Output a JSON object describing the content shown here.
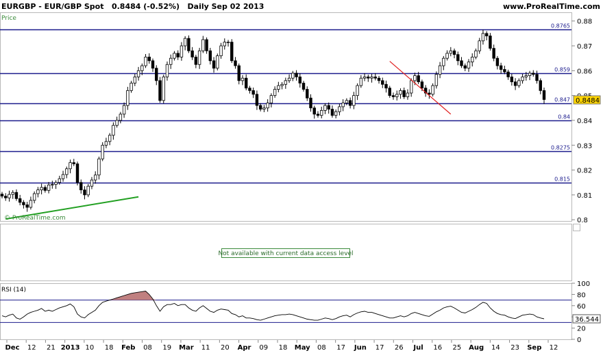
{
  "header": {
    "symbol": "EURGBP - EUR/GBP Spot",
    "price_change": "0.8484 (-0.52%)",
    "period_date": "Daily  Sep 02 2013",
    "site": "www.ProRealTime.com"
  },
  "price_panel": {
    "label": "Price",
    "watermark": "© ProRealTime.com",
    "current_price_label": "0.8484",
    "y_axis_ticks": [
      "0.88",
      "0.87",
      "0.86",
      "0.85",
      "0.84",
      "0.83",
      "0.82",
      "0.81",
      "0.8"
    ],
    "levels": [
      {
        "value": 0.8765,
        "label": "0.8765"
      },
      {
        "value": 0.859,
        "label": "0.859"
      },
      {
        "value": 0.847,
        "label": "0.847"
      },
      {
        "value": 0.84,
        "label": "0.84"
      },
      {
        "value": 0.8275,
        "label": "0.8275"
      },
      {
        "value": 0.815,
        "label": "0.815"
      }
    ]
  },
  "middle_panel": {
    "message": "Not available with current data access level"
  },
  "rsi_panel": {
    "label": "RSI (14)",
    "current_value_label": "36.544",
    "y_axis_ticks": [
      "100",
      "80",
      "60",
      "40",
      "20",
      "0"
    ],
    "upper_band": 70,
    "lower_band": 30
  },
  "x_axis_labels": [
    {
      "text": "Dec",
      "bold": true
    },
    {
      "text": "12",
      "bold": false
    },
    {
      "text": "21",
      "bold": false
    },
    {
      "text": "2013",
      "bold": true
    },
    {
      "text": "10",
      "bold": false
    },
    {
      "text": "18",
      "bold": false
    },
    {
      "text": "Feb",
      "bold": true
    },
    {
      "text": "08",
      "bold": false
    },
    {
      "text": "19",
      "bold": false
    },
    {
      "text": "Mar",
      "bold": true
    },
    {
      "text": "11",
      "bold": false
    },
    {
      "text": "20",
      "bold": false
    },
    {
      "text": "Apr",
      "bold": true
    },
    {
      "text": "09",
      "bold": false
    },
    {
      "text": "18",
      "bold": false
    },
    {
      "text": "May",
      "bold": true
    },
    {
      "text": "08",
      "bold": false
    },
    {
      "text": "17",
      "bold": false
    },
    {
      "text": "Jun",
      "bold": true
    },
    {
      "text": "17",
      "bold": false
    },
    {
      "text": "26",
      "bold": false
    },
    {
      "text": "Jul",
      "bold": true
    },
    {
      "text": "16",
      "bold": false
    },
    {
      "text": "25",
      "bold": false
    },
    {
      "text": "Aug",
      "bold": true
    },
    {
      "text": "14",
      "bold": false
    },
    {
      "text": "23",
      "bold": false
    },
    {
      "text": "Sep",
      "bold": true
    },
    {
      "text": "12",
      "bold": false
    }
  ],
  "chart_data": {
    "type": "candlestick",
    "ylim": [
      0.7995,
      0.8835
    ],
    "price_close": [
      0.8095,
      0.8088,
      0.8102,
      0.811,
      0.8085,
      0.807,
      0.806,
      0.805,
      0.8078,
      0.8105,
      0.812,
      0.813,
      0.8118,
      0.814,
      0.8142,
      0.815,
      0.8165,
      0.8182,
      0.8205,
      0.823,
      0.8225,
      0.815,
      0.812,
      0.81,
      0.8135,
      0.816,
      0.818,
      0.8245,
      0.83,
      0.8315,
      0.834,
      0.838,
      0.84,
      0.8425,
      0.846,
      0.852,
      0.855,
      0.8575,
      0.86,
      0.862,
      0.8655,
      0.864,
      0.861,
      0.856,
      0.848,
      0.8575,
      0.8625,
      0.865,
      0.867,
      0.8655,
      0.87,
      0.873,
      0.868,
      0.8655,
      0.8625,
      0.868,
      0.8725,
      0.868,
      0.864,
      0.861,
      0.866,
      0.87,
      0.8715,
      0.8715,
      0.864,
      0.862,
      0.856,
      0.857,
      0.853,
      0.852,
      0.8505,
      0.846,
      0.8445,
      0.845,
      0.847,
      0.85,
      0.8525,
      0.854,
      0.8545,
      0.856,
      0.857,
      0.859,
      0.8575,
      0.855,
      0.8525,
      0.849,
      0.845,
      0.8425,
      0.842,
      0.844,
      0.846,
      0.8445,
      0.842,
      0.8435,
      0.8455,
      0.847,
      0.848,
      0.846,
      0.85,
      0.854,
      0.857,
      0.8575,
      0.857,
      0.8575,
      0.857,
      0.856,
      0.8545,
      0.853,
      0.85,
      0.8495,
      0.8505,
      0.852,
      0.8495,
      0.851,
      0.856,
      0.858,
      0.8555,
      0.853,
      0.851,
      0.8505,
      0.854,
      0.8585,
      0.862,
      0.865,
      0.867,
      0.868,
      0.8665,
      0.864,
      0.862,
      0.861,
      0.8635,
      0.8655,
      0.868,
      0.872,
      0.875,
      0.874,
      0.869,
      0.865,
      0.862,
      0.8605,
      0.8595,
      0.8575,
      0.8555,
      0.854,
      0.856,
      0.8575,
      0.858,
      0.859,
      0.8585,
      0.856,
      0.852,
      0.8484
    ],
    "rsi": [
      42,
      40,
      43,
      45,
      38,
      36,
      40,
      45,
      48,
      50,
      52,
      55,
      50,
      52,
      50,
      53,
      56,
      58,
      60,
      63,
      58,
      45,
      40,
      38,
      44,
      48,
      52,
      60,
      66,
      68,
      70,
      72,
      74,
      76,
      78,
      80,
      82,
      83,
      84,
      85,
      86,
      80,
      72,
      60,
      50,
      58,
      62,
      62,
      64,
      60,
      62,
      62,
      56,
      52,
      50,
      56,
      60,
      55,
      50,
      48,
      52,
      54,
      53,
      52,
      46,
      44,
      40,
      42,
      38,
      38,
      37,
      35,
      34,
      36,
      38,
      40,
      42,
      43,
      44,
      44,
      45,
      44,
      42,
      40,
      38,
      36,
      35,
      34,
      34,
      36,
      38,
      37,
      35,
      37,
      40,
      42,
      43,
      40,
      44,
      47,
      49,
      50,
      48,
      48,
      46,
      44,
      42,
      40,
      38,
      38,
      40,
      42,
      40,
      42,
      46,
      48,
      46,
      44,
      42,
      41,
      45,
      49,
      52,
      56,
      58,
      59,
      56,
      52,
      48,
      47,
      50,
      53,
      57,
      62,
      66,
      64,
      56,
      50,
      46,
      44,
      43,
      40,
      38,
      37,
      40,
      43,
      44,
      45,
      44,
      40,
      38,
      36.544
    ],
    "trend_lines": [
      {
        "color": "#22a022",
        "from": {
          "bar": 1,
          "price": 0.8003
        },
        "to": {
          "bar": 38,
          "price": 0.8092
        }
      },
      {
        "color": "#e02020",
        "from": {
          "bar": 108,
          "price": 0.8638
        },
        "to": {
          "bar": 125,
          "price": 0.8425
        }
      }
    ]
  }
}
